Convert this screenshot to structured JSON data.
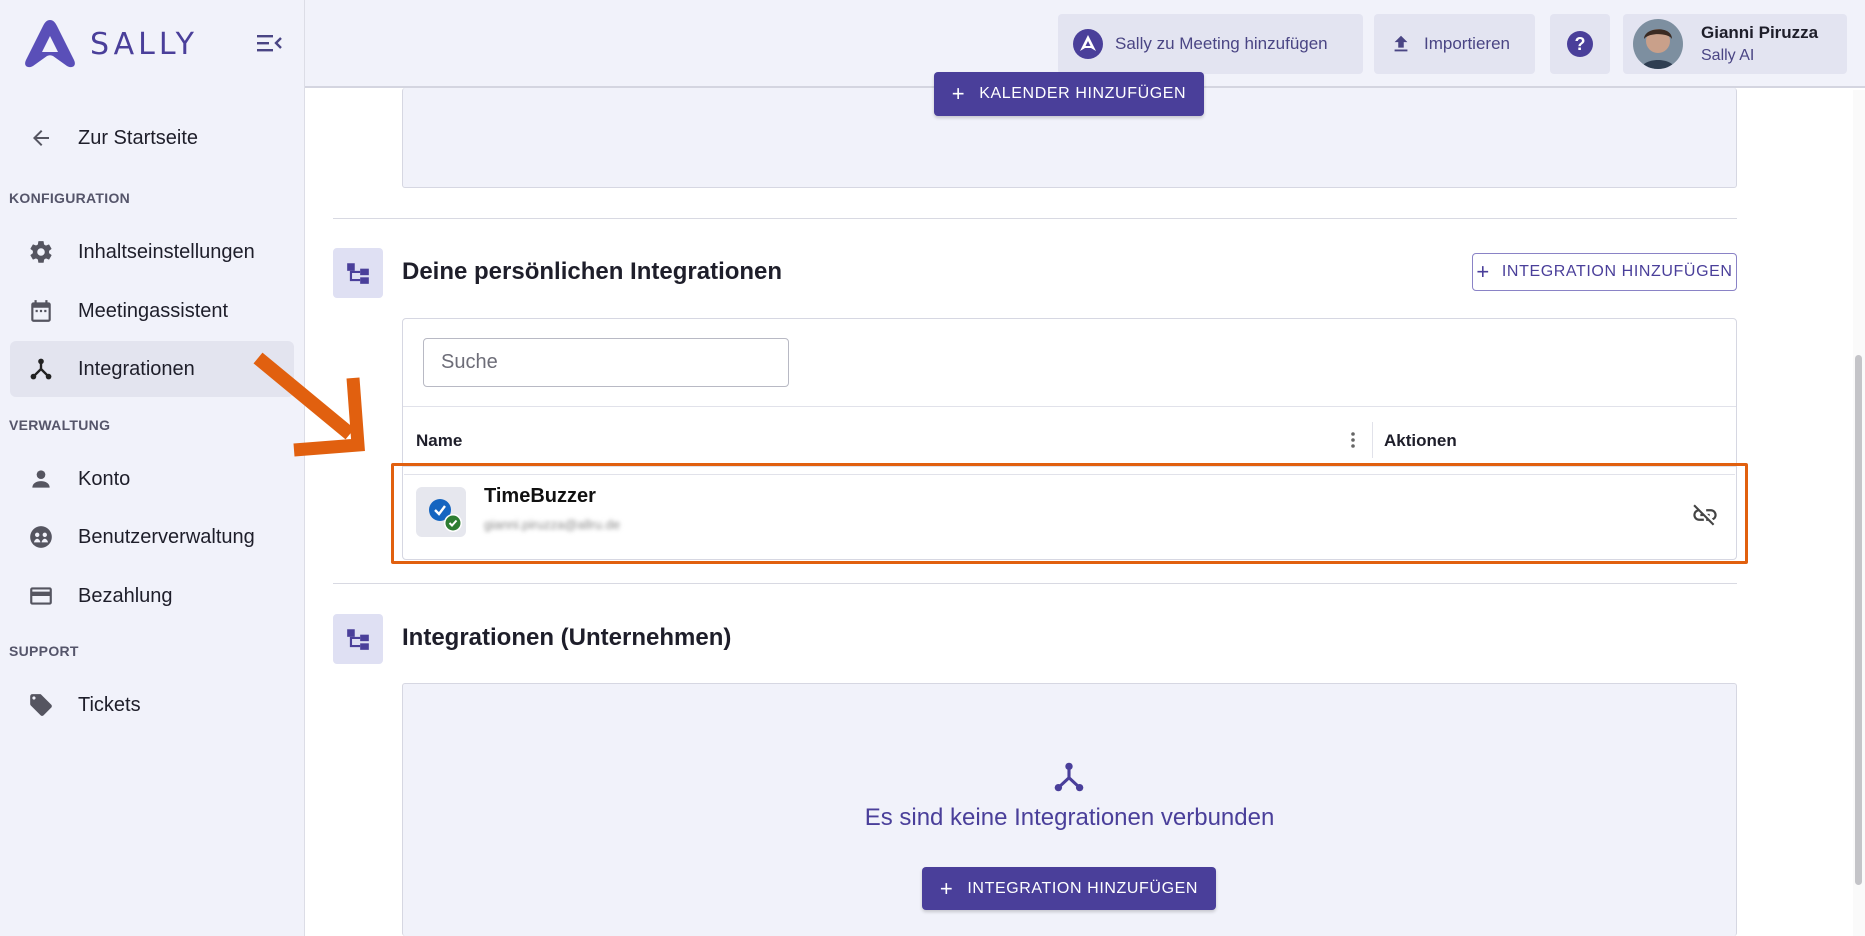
{
  "app": {
    "logo_text": "SALLY"
  },
  "sidebar": {
    "back_label": "Zur Startseite",
    "sections": {
      "config": "KONFIGURATION",
      "admin": "VERWALTUNG",
      "support": "SUPPORT"
    },
    "items": [
      {
        "label": "Inhaltseinstellungen"
      },
      {
        "label": "Meetingassistent"
      },
      {
        "label": "Integrationen",
        "active": true
      },
      {
        "label": "Konto"
      },
      {
        "label": "Benutzerverwaltung"
      },
      {
        "label": "Bezahlung"
      },
      {
        "label": "Tickets"
      }
    ]
  },
  "header": {
    "add_meeting": "Sally zu Meeting hinzufügen",
    "import": "Importieren",
    "help": "?",
    "user_name": "Gianni Piruzza",
    "user_org": "Sally AI"
  },
  "calendar": {
    "add_button": "KALENDER HINZUFÜGEN"
  },
  "personal": {
    "title": "Deine persönlichen Integrationen",
    "add_button": "INTEGRATION HINZUFÜGEN",
    "search_placeholder": "Suche",
    "col_name": "Name",
    "col_actions": "Aktionen",
    "rows": [
      {
        "name": "TimeBuzzer",
        "email": "gianni.piruzza@allru.de"
      }
    ]
  },
  "company": {
    "title": "Integrationen (Unternehmen)",
    "empty_text": "Es sind keine Integrationen verbunden",
    "add_button": "INTEGRATION HINZUFÜGEN"
  },
  "colors": {
    "primary": "#4a3f9a",
    "highlight": "#e1600f",
    "sidebar_bg": "#f1f2fa"
  }
}
